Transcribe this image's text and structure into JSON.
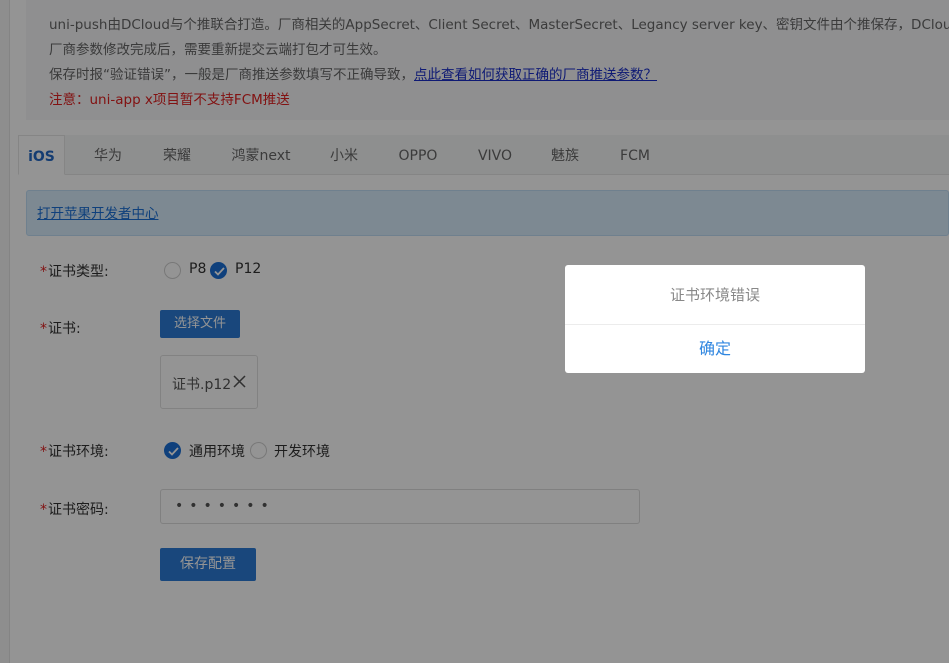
{
  "notice": {
    "line1": "uni-push由DCloud与个推联合打造。厂商相关的AppSecret、Client Secret、MasterSecret、Legancy server key、密钥文件由个推保存，DCloud不保存。",
    "line2": "厂商参数修改完成后，需要重新提交云端打包才可生效。",
    "line3_prefix": "保存时报“验证错误”，一般是厂商推送参数填写不正确导致，",
    "line3_link": "点此查看如何获取正确的厂商推送参数？",
    "line4": "注意：uni-app x项目暂不支持FCM推送"
  },
  "tabs": [
    "iOS",
    "华为",
    "荣耀",
    "鸿蒙next",
    "小米",
    "OPPO",
    "VIVO",
    "魅族",
    "FCM"
  ],
  "active_tab": "iOS",
  "infobar_link": "打开苹果开发者中心",
  "form": {
    "cert_type": {
      "required_mark": "*",
      "label": "证书类型:",
      "options": [
        "P8",
        "P12"
      ],
      "selected": "P12"
    },
    "cert": {
      "required_mark": "*",
      "label": "证书:",
      "choose_button": "选择文件",
      "file_name": "证书.p12"
    },
    "cert_env": {
      "required_mark": "*",
      "label": "证书环境:",
      "options": [
        "通用环境",
        "开发环境"
      ],
      "selected": "通用环境"
    },
    "cert_password": {
      "required_mark": "*",
      "label": "证书密码:",
      "masked_value": "•••••••"
    },
    "save_button": "保存配置"
  },
  "dialog": {
    "message": "证书环境错误",
    "confirm": "确定"
  },
  "colors": {
    "primary": "#2c7bd6",
    "link": "#1a2ec9",
    "warning": "#e02020",
    "dialog_button": "#2f86e0"
  }
}
